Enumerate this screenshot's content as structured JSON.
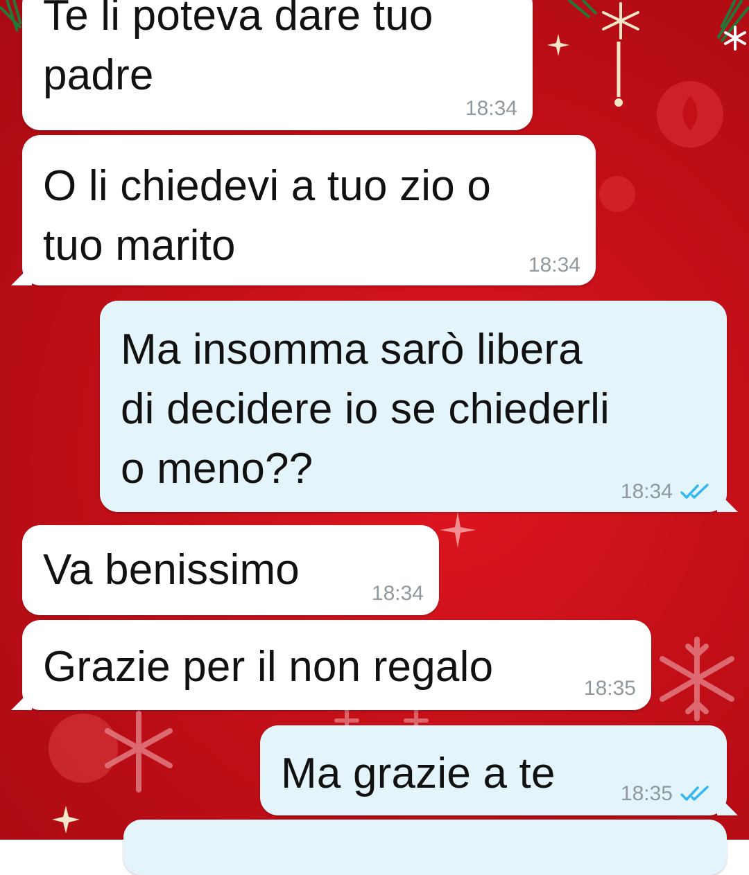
{
  "chat": {
    "messages": [
      {
        "id": "m1",
        "direction": "incoming",
        "text": "Te li poteva dare tuo\npadre",
        "time": "18:34"
      },
      {
        "id": "m2",
        "direction": "incoming",
        "text": "O li chiedevi a tuo zio o\ntuo marito",
        "time": "18:34"
      },
      {
        "id": "m3",
        "direction": "outgoing",
        "text": "Ma insomma sarò libera\ndi decidere io se chiederli\no meno??",
        "time": "18:34",
        "status": "read"
      },
      {
        "id": "m4",
        "direction": "incoming",
        "text": "Va benissimo",
        "time": "18:34"
      },
      {
        "id": "m5",
        "direction": "incoming",
        "text": "Grazie per il non regalo",
        "time": "18:35"
      },
      {
        "id": "m6",
        "direction": "outgoing",
        "text": "Ma grazie a te",
        "time": "18:35",
        "status": "read"
      }
    ]
  },
  "theme": {
    "background": "#c80f18",
    "incoming_bubble": "#ffffff",
    "outgoing_bubble": "#e4f4fb",
    "timestamp_color": "#8e989d",
    "read_ticks_color": "#34b7f1",
    "wallpaper": "christmas-red-snowflakes",
    "icons": [
      "snowflake-icon",
      "star-icon",
      "double-check-icon"
    ]
  }
}
